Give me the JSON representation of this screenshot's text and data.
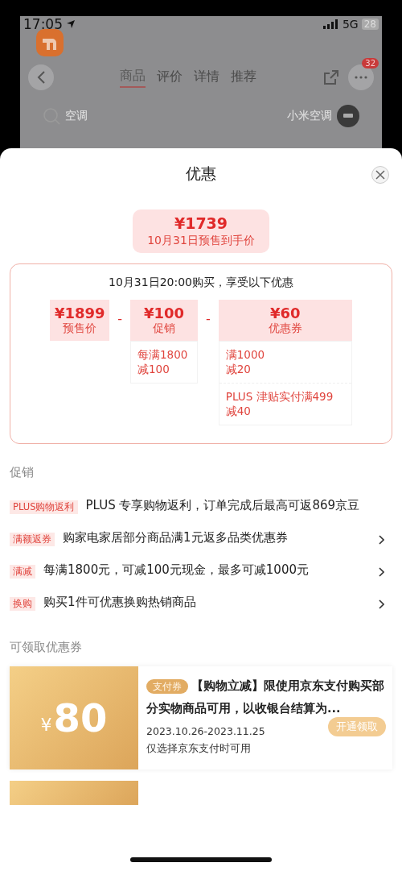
{
  "status_bar": {
    "time": "17:05",
    "network": "5G",
    "battery": "28"
  },
  "background_page": {
    "tabs": [
      {
        "label": "商品",
        "selected": true
      },
      {
        "label": "评价",
        "selected": false
      },
      {
        "label": "详情",
        "selected": false
      },
      {
        "label": "推荐",
        "selected": false
      }
    ],
    "badge": "32",
    "search": {
      "value": "空调"
    },
    "suggestion": "小米空调"
  },
  "sheet": {
    "title": "优惠",
    "final_price": {
      "amount": "¥1739",
      "label": "10月31日预售到手价"
    },
    "breakdown": {
      "heading": "10月31日20:00购买，享受以下优惠",
      "parts": [
        {
          "amount": "¥1899",
          "label": "预售价"
        },
        {
          "amount": "¥100",
          "label": "促销",
          "details": [
            "每满1800\n减100"
          ]
        },
        {
          "amount": "¥60",
          "label": "优惠券",
          "details": [
            "满1000\n减20",
            "PLUS 津贴实付满499\n减40"
          ]
        }
      ],
      "operator": "-"
    },
    "promotions": {
      "heading": "促销",
      "items": [
        {
          "tag": "PLUS购物返利",
          "text": "PLUS 专享购物返利，订单完成后最高可返869京豆",
          "has_arrow": false
        },
        {
          "tag": "满额返券",
          "text": "购家电家居部分商品满1元返多品类优惠券",
          "has_arrow": true
        },
        {
          "tag": "满减",
          "text": "每满1800元，可减100元现金，最多可减1000元",
          "has_arrow": true
        },
        {
          "tag": "换购",
          "text": "购买1件可优惠换购热销商品",
          "has_arrow": true
        }
      ]
    },
    "coupons": {
      "heading": "可领取优惠券",
      "items": [
        {
          "currency": "¥",
          "amount": "80",
          "tag": "支付券",
          "title": "【购物立减】限使用京东支付购买部分实物商品可用，以收银台结算为...",
          "dates": "2023.10.26-2023.11.25",
          "note": "仅选择京东支付时可用",
          "action": "开通领取"
        }
      ]
    }
  }
}
